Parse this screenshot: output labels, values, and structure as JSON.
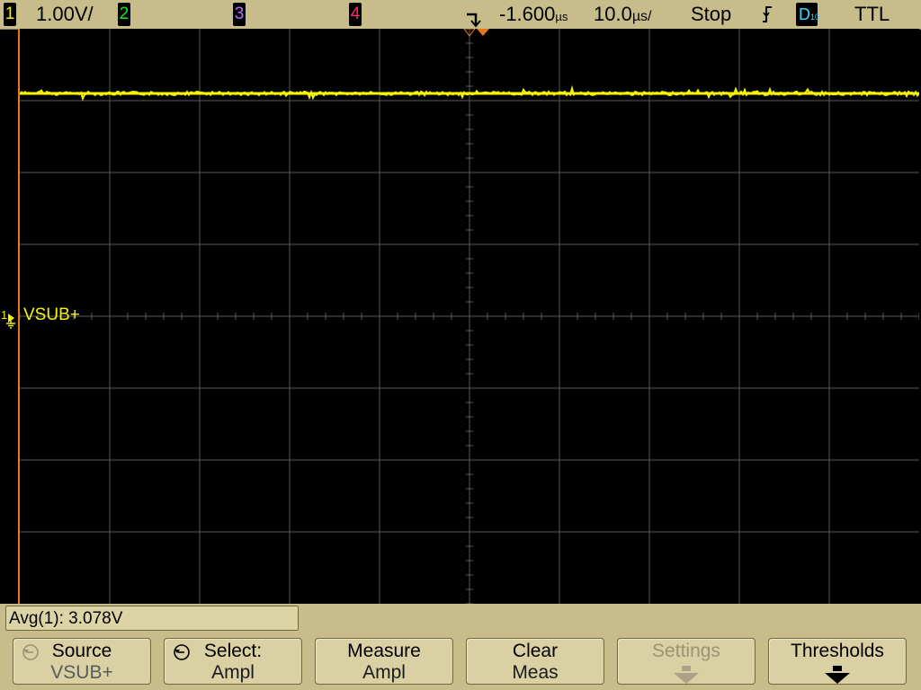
{
  "status": {
    "ch1_num": "1",
    "ch1_scale": "1.00V/",
    "ch2_num": "2",
    "ch3_num": "3",
    "ch4_num": "4",
    "trigger_delay": "-1.600",
    "delay_unit": "µs",
    "timebase": "10.0",
    "timebase_unit": "µs/",
    "run_state": "Stop",
    "trigger_slope_icon": "falling-edge-icon",
    "digital_label": "D",
    "digital_sub": "10",
    "logic_level": "TTL"
  },
  "display": {
    "ground_marker": "1",
    "trace_label": "VSUB+",
    "trace_color": "#f4f400",
    "grid_color": "#5a5a5a",
    "edge_color": "#e0791c"
  },
  "measurement": {
    "readout": "Avg(1): 3.078V"
  },
  "softkeys": [
    {
      "line1": "Source",
      "line2": "VSUB+"
    },
    {
      "line1": "Select:",
      "line2": "Ampl"
    },
    {
      "line1": "Measure",
      "line2": "Ampl"
    },
    {
      "line1": "Clear",
      "line2": "Meas"
    },
    {
      "line1": "Settings",
      "line2": ""
    },
    {
      "line1": "Thresholds",
      "line2": ""
    }
  ]
}
